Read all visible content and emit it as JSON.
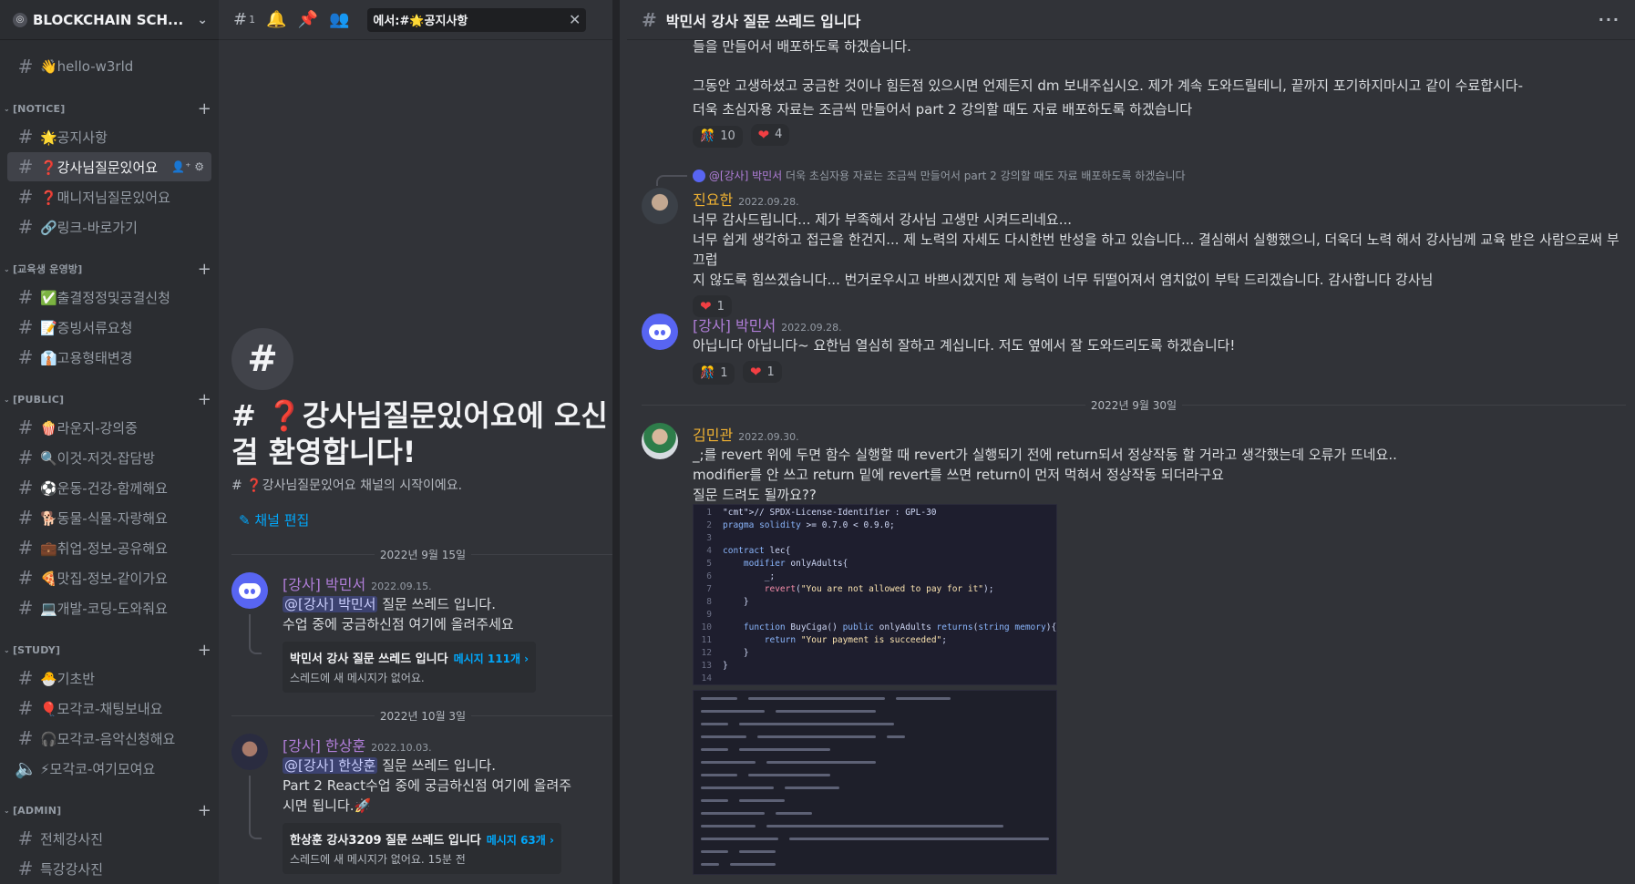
{
  "server": {
    "name": "BLOCKCHAIN SCH...",
    "boost_icon": "boost-icon"
  },
  "sidebar": {
    "top_channel": {
      "label": "👋hello-w3rld"
    },
    "categories": [
      {
        "name": "[NOTICE]",
        "channels": [
          {
            "label": "🌟공지사항"
          },
          {
            "label": "❓강사님질문있어요",
            "active": true
          },
          {
            "label": "❓매니저님질문있어요"
          },
          {
            "label": "🔗링크-바로가기"
          }
        ]
      },
      {
        "name": "[교육생 운영방]",
        "channels": [
          {
            "label": "✅출결정정및공결신청"
          },
          {
            "label": "📝증빙서류요청"
          },
          {
            "label": "👔고용형태변경"
          }
        ]
      },
      {
        "name": "[PUBLIC]",
        "channels": [
          {
            "label": "🍿라운지-강의중"
          },
          {
            "label": "🔍이것-저것-잡담방"
          },
          {
            "label": "⚽운동-건강-함께해요"
          },
          {
            "label": "🐕동물-식물-자랑해요"
          },
          {
            "label": "💼취업-정보-공유해요"
          },
          {
            "label": "🍕맛집-정보-같이가요"
          },
          {
            "label": "💻개발-코딩-도와줘요"
          }
        ]
      },
      {
        "name": "[STUDY]",
        "channels": [
          {
            "label": "🐣기초반"
          },
          {
            "label": "🎈모각코-채팅보내요"
          },
          {
            "label": "🎧모각코-음악신청해요"
          },
          {
            "label": "⚡모각코-여기모여요",
            "voice": true
          }
        ]
      },
      {
        "name": "[ADMIN]",
        "channels": [
          {
            "label": "전체강사진"
          },
          {
            "label": "특강강사진"
          }
        ]
      }
    ]
  },
  "middle": {
    "header": {
      "threads_count": "1",
      "search_value": "에서:#🌟공지사항"
    },
    "welcome": {
      "title": "# ❓강사님질문있어요에 오신 걸 환영합니다!",
      "subtitle": "# ❓강사님질문있어요 채널의 시작이에요.",
      "edit_label": "채널 편집"
    },
    "dividers": [
      "2022년 9월 15일",
      "2022년 10월 3일"
    ],
    "messages": [
      {
        "author": "[강사] 박민서",
        "time": "2022.09.15.",
        "mention": "@[강사] 박민서",
        "text1": " 질문 쓰레드 입니다.",
        "text2": "수업 중에 궁금하신점 여기에 올려주세요",
        "thread": {
          "title": "박민서 강사 질문 쓰레드 입니다",
          "count": "메시지 111개 ›",
          "status": "스레드에 새 메시지가 없어요."
        }
      },
      {
        "author": "[강사] 한상훈",
        "time": "2022.10.03.",
        "mention": "@[강사] 한상훈",
        "text1": " 질문 쓰레드 입니다.",
        "text2": "Part 2 React수업 중에  궁금하신점 여기에 올려주",
        "text3": "시면 됩니다.🚀",
        "thread": {
          "title": "한상훈 강사3209 질문 쓰레드 입니다",
          "count": "메시지 63개 ›",
          "status": "스레드에 새 메시지가 없어요.",
          "status_time": "15분 전"
        }
      }
    ]
  },
  "thread": {
    "title": "박민서 강사 질문 쓰레드 입니다",
    "top_lines": [
      "들을 만들어서 배포하도록 하겠습니다.",
      "그동안 고생하셨고 궁금한 것이나 힘든점 있으시면 언제든지 dm 보내주십시오. 제가 계속 도와드릴테니, 끝까지 포기하지마시고 같이 수료합시다-",
      "더욱 초심자용 자료는 조금씩 만들어서 part 2 강의할 때도 자료 배포하도록 하겠습니다"
    ],
    "top_reactions": [
      {
        "emoji": "🎊",
        "count": "10"
      },
      {
        "emoji": "❤",
        "count": "4"
      }
    ],
    "reply_ref": {
      "name": "@[강사] 박민서",
      "text": " 더욱 초심자용 자료는 조금씩 만들어서 part 2 강의할 때도 자료 배포하도록 하겠습니다"
    },
    "msg1": {
      "author": "진요한",
      "time": "2022.09.28.",
      "lines": [
        "너무 감사드립니다... 제가 부족해서 강사님 고생만 시켜드리네요...",
        "너무 쉽게 생각하고 접근을 한건지... 제 노력의 자세도 다시한번 반성을 하고 있습니다... 결심해서 실행했으니, 더욱더 노력 해서 강사님께 교육 받은 사람으로써 부끄럽",
        "지 않도록 힘쓰겠습니다...  번거로우시고 바쁘시겠지만 제 능력이 너무 뒤떨어져서 염치없이 부탁 드리겠습니다. 감사합니다 강사님"
      ],
      "reactions": [
        {
          "emoji": "❤",
          "count": "1"
        }
      ]
    },
    "msg2": {
      "author": "[강사] 박민서",
      "time": "2022.09.28.",
      "lines": [
        "아닙니다 아닙니다~ 요한님 열심히 잘하고 계십니다. 저도 옆에서 잘 도와드리도록 하겠습니다!"
      ],
      "reactions": [
        {
          "emoji": "🎊",
          "count": "1"
        },
        {
          "emoji": "❤",
          "count": "1"
        }
      ]
    },
    "divider": "2022년 9월 30일",
    "msg3": {
      "author": "김민관",
      "time": "2022.09.30.",
      "lines": [
        "_;를 revert 위에 두면 함수 실행할 때 revert가 실행되기 전에 return되서 정상작동 할 거라고 생각했는데 오류가 뜨네요..",
        "modifier를 안 쓰고 return 밑에 revert를 쓰면 return이 먼저 먹혀서 정상작동 되더라구요",
        "질문 드려도 될까요??"
      ]
    },
    "code_lines": [
      "// SPDX-License-Identifier : GPL-30",
      "pragma solidity >= 0.7.0 < 0.9.0;",
      "",
      "contract lec{",
      "    modifier onlyAdults{",
      "        _;",
      "        revert(\"You are not allowed to pay for it\");",
      "    }",
      "",
      "    function BuyCiga() public onlyAdults returns(string memory){",
      "        return \"Your payment is succeeded\";",
      "    }",
      "}",
      ""
    ]
  },
  "colors": {
    "accent": "#5865f2",
    "link": "#00a8fc",
    "instructor_name": "#b07ed8",
    "member_name": "#f0b232"
  }
}
